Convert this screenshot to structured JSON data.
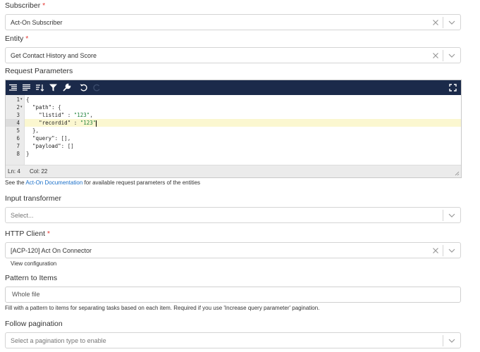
{
  "subscriber": {
    "label": "Subscriber",
    "required": "*",
    "value": "Act-On Subscriber"
  },
  "entity": {
    "label": "Entity",
    "required": "*",
    "value": "Get Contact History and Score"
  },
  "request_parameters": {
    "label": "Request Parameters",
    "lines": [
      {
        "n": "1",
        "fold": "▾",
        "text": "{"
      },
      {
        "n": "2",
        "fold": "▾",
        "text": "  \"path\": {"
      },
      {
        "n": "3",
        "fold": "",
        "text": "    \"listid\" : \"123\","
      },
      {
        "n": "4",
        "fold": "",
        "text": "    \"recordid\" : \"123\""
      },
      {
        "n": "5",
        "fold": "",
        "text": "  },"
      },
      {
        "n": "6",
        "fold": "",
        "text": "  \"query\": [],"
      },
      {
        "n": "7",
        "fold": "",
        "text": "  \"payload\": []"
      },
      {
        "n": "8",
        "fold": "",
        "text": "}"
      }
    ],
    "status_ln": "Ln: 4",
    "status_col": "Col: 22",
    "help_prefix": "See the ",
    "help_link": "Act-On Documentation",
    "help_suffix": " for available request parameters of the entities"
  },
  "input_transformer": {
    "label": "Input transformer",
    "placeholder": "Select..."
  },
  "http_client": {
    "label": "HTTP Client",
    "required": "*",
    "value": "[ACP-120] Act On Connector",
    "view_config": "View configuration"
  },
  "pattern_to_items": {
    "label": "Pattern to Items",
    "placeholder": "Whole file",
    "help": "Fill with a pattern to items for separating tasks based on each item. Required if you use 'Increase query parameter' pagination."
  },
  "follow_pagination": {
    "label": "Follow pagination",
    "placeholder": "Select a pagination type to enable"
  },
  "colors": {
    "toolbar": "#1b2a4a",
    "link": "#1a6fc9",
    "required": "#e53935",
    "active_line": "#fbf7d0"
  },
  "icons": [
    "clear-icon",
    "chevron-down-icon",
    "format-icon",
    "compact-icon",
    "sort-icon",
    "filter-icon",
    "repair-icon",
    "undo-icon",
    "redo-icon",
    "fullscreen-icon"
  ]
}
